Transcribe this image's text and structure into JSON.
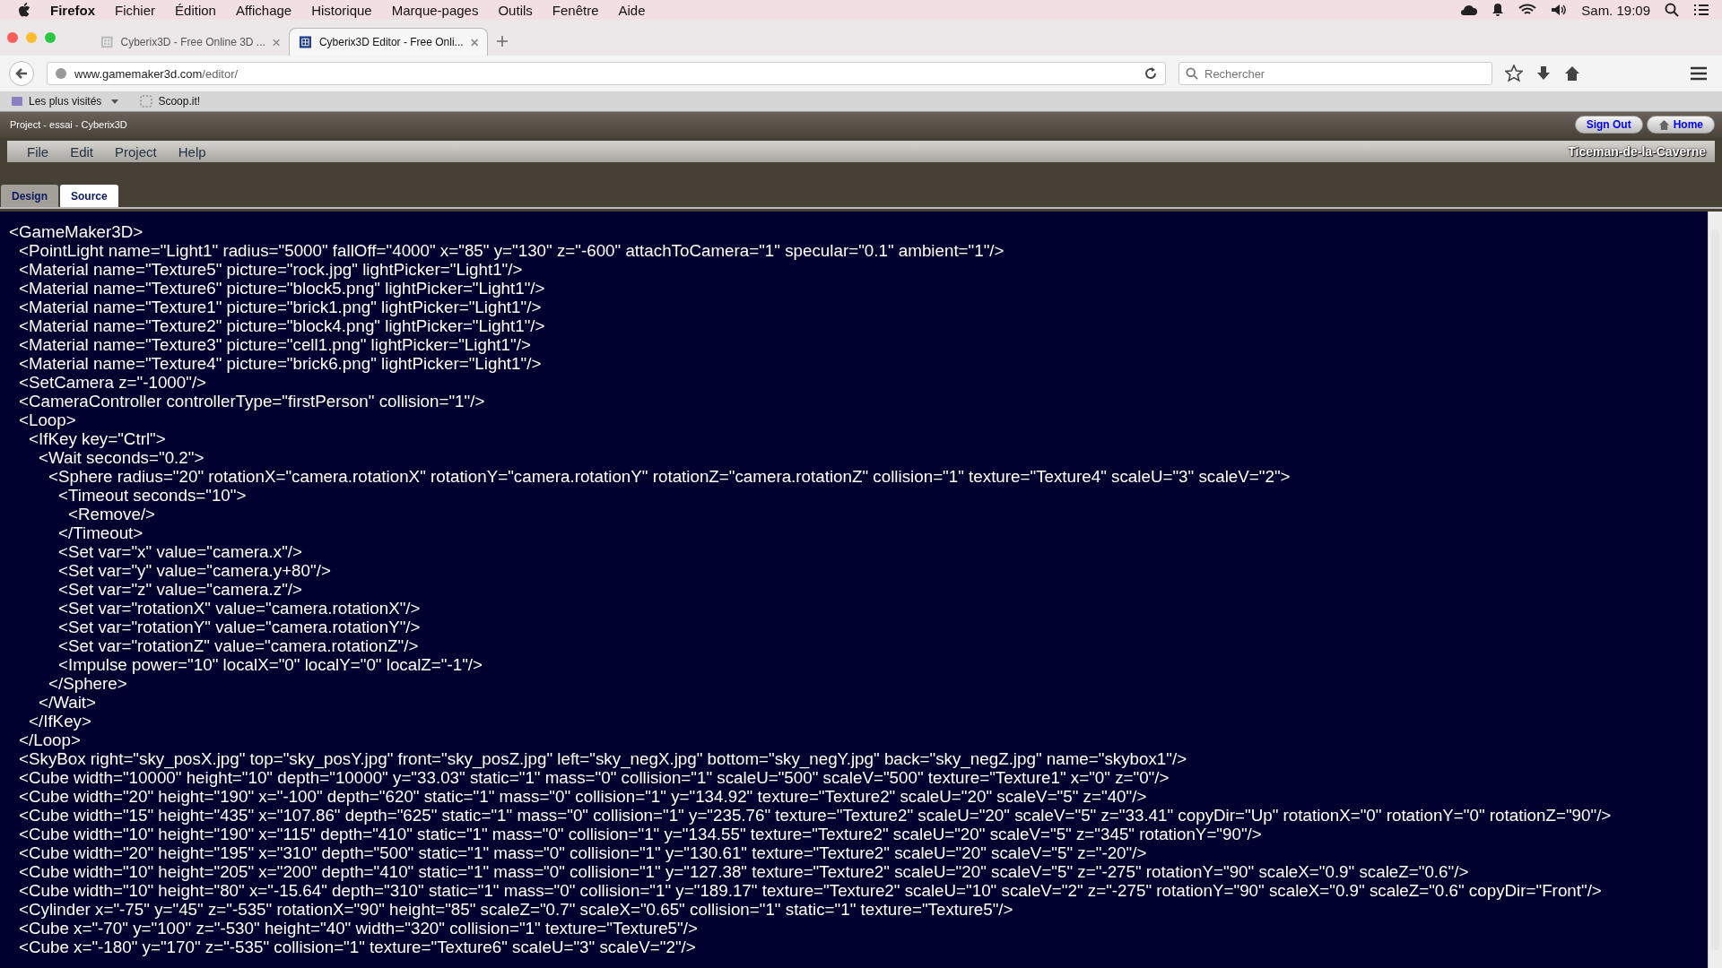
{
  "os_menu": {
    "app": "Firefox",
    "items": [
      "Fichier",
      "Édition",
      "Affichage",
      "Historique",
      "Marque-pages",
      "Outils",
      "Fenêtre",
      "Aide"
    ],
    "clock": "Sam. 19:09"
  },
  "browser_tabs": [
    {
      "title": "Cyberix3D - Free Online 3D ...",
      "selected": false
    },
    {
      "title": "Cyberix3D Editor - Free Onli...",
      "selected": true
    }
  ],
  "address_bar": {
    "domain": "www.gamemaker3d.com",
    "path": "/editor/"
  },
  "search": {
    "placeholder": "Rechercher"
  },
  "bookmarks": [
    {
      "label": "Les plus visités",
      "dropdown": true
    },
    {
      "label": "Scoop.it!",
      "dropdown": false
    }
  ],
  "app": {
    "title": "Project - essai - Cyberix3D",
    "buttons": [
      {
        "label": "Sign Out",
        "kind": "plain"
      },
      {
        "label": "Home",
        "kind": "home"
      }
    ],
    "menu": [
      "File",
      "Edit",
      "Project",
      "Help"
    ],
    "user": "Ticeman-de-la-Caverne",
    "tabs": [
      {
        "label": "Design",
        "selected": false
      },
      {
        "label": "Source",
        "selected": true
      }
    ]
  },
  "source": [
    {
      "text": "<GameMaker3D>",
      "children": [
        {
          "text": "<PointLight name=\"Light1\" radius=\"5000\" fallOff=\"4000\" x=\"85\" y=\"130\" z=\"-600\" attachToCamera=\"1\" specular=\"0.1\" ambient=\"1\"/>"
        },
        {
          "text": "<Material name=\"Texture5\" picture=\"rock.jpg\" lightPicker=\"Light1\"/>"
        },
        {
          "text": "<Material name=\"Texture6\" picture=\"block5.png\" lightPicker=\"Light1\"/>"
        },
        {
          "text": "<Material name=\"Texture1\" picture=\"brick1.png\" lightPicker=\"Light1\"/>"
        },
        {
          "text": "<Material name=\"Texture2\" picture=\"block4.png\" lightPicker=\"Light1\"/>"
        },
        {
          "text": "<Material name=\"Texture3\" picture=\"cell1.png\" lightPicker=\"Light1\"/>"
        },
        {
          "text": "<Material name=\"Texture4\" picture=\"brick6.png\" lightPicker=\"Light1\"/>"
        },
        {
          "text": "<SetCamera z=\"-1000\"/>"
        },
        {
          "text": "<CameraController controllerType=\"firstPerson\" collision=\"1\"/>"
        },
        {
          "text": "<Loop>",
          "children": [
            {
              "text": "<IfKey key=\"Ctrl\">",
              "children": [
                {
                  "text": "<Wait seconds=\"0.2\">",
                  "children": [
                    {
                      "text": "<Sphere radius=\"20\" rotationX=\"camera.rotationX\" rotationY=\"camera.rotationY\" rotationZ=\"camera.rotationZ\" collision=\"1\" texture=\"Texture4\" scaleU=\"3\" scaleV=\"2\">",
                      "children": [
                        {
                          "text": "<Timeout seconds=\"10\">",
                          "children": [
                            {
                              "text": "<Remove/>"
                            }
                          ]
                        },
                        {
                          "text": "</Timeout>"
                        },
                        {
                          "text": "<Set var=\"x\" value=\"camera.x\"/>"
                        },
                        {
                          "text": "<Set var=\"y\" value=\"camera.y+80\"/>"
                        },
                        {
                          "text": "<Set var=\"z\" value=\"camera.z\"/>"
                        },
                        {
                          "text": "<Set var=\"rotationX\" value=\"camera.rotationX\"/>"
                        },
                        {
                          "text": "<Set var=\"rotationY\" value=\"camera.rotationY\"/>"
                        },
                        {
                          "text": "<Set var=\"rotationZ\" value=\"camera.rotationZ\"/>"
                        },
                        {
                          "text": "<Impulse power=\"10\" localX=\"0\" localY=\"0\" localZ=\"-1\"/>"
                        }
                      ]
                    },
                    {
                      "text": "</Sphere>"
                    }
                  ]
                },
                {
                  "text": "</Wait>"
                }
              ]
            },
            {
              "text": "</IfKey>"
            }
          ]
        },
        {
          "text": "</Loop>"
        },
        {
          "text": "<SkyBox right=\"sky_posX.jpg\" top=\"sky_posY.jpg\" front=\"sky_posZ.jpg\" left=\"sky_negX.jpg\" bottom=\"sky_negY.jpg\" back=\"sky_negZ.jpg\" name=\"skybox1\"/>"
        },
        {
          "text": "<Cube width=\"10000\" height=\"10\" depth=\"10000\" y=\"33.03\" static=\"1\" mass=\"0\" collision=\"1\" scaleU=\"500\" scaleV=\"500\" texture=\"Texture1\" x=\"0\" z=\"0\"/>"
        },
        {
          "text": "<Cube width=\"20\" height=\"190\" x=\"-100\" depth=\"620\" static=\"1\" mass=\"0\" collision=\"1\" y=\"134.92\" texture=\"Texture2\" scaleU=\"20\" scaleV=\"5\" z=\"40\"/>"
        },
        {
          "text": "<Cube width=\"15\" height=\"435\" x=\"107.86\" depth=\"625\" static=\"1\" mass=\"0\" collision=\"1\" y=\"235.76\" texture=\"Texture2\" scaleU=\"20\" scaleV=\"5\" z=\"33.41\" copyDir=\"Up\" rotationX=\"0\" rotationY=\"0\" rotationZ=\"90\"/>"
        },
        {
          "text": "<Cube width=\"10\" height=\"190\" x=\"115\" depth=\"410\" static=\"1\" mass=\"0\" collision=\"1\" y=\"134.55\" texture=\"Texture2\" scaleU=\"20\" scaleV=\"5\" z=\"345\" rotationY=\"90\"/>"
        },
        {
          "text": "<Cube width=\"20\" height=\"195\" x=\"310\" depth=\"500\" static=\"1\" mass=\"0\" collision=\"1\" y=\"130.61\" texture=\"Texture2\" scaleU=\"20\" scaleV=\"5\" z=\"-20\"/>"
        },
        {
          "text": "<Cube width=\"10\" height=\"205\" x=\"200\" depth=\"410\" static=\"1\" mass=\"0\" collision=\"1\" y=\"127.38\" texture=\"Texture2\" scaleU=\"20\" scaleV=\"5\" z=\"-275\" rotationY=\"90\" scaleX=\"0.9\" scaleZ=\"0.6\"/>"
        },
        {
          "text": "<Cube width=\"10\" height=\"80\" x=\"-15.64\" depth=\"310\" static=\"1\" mass=\"0\" collision=\"1\" y=\"189.17\" texture=\"Texture2\" scaleU=\"10\" scaleV=\"2\" z=\"-275\" rotationY=\"90\" scaleX=\"0.9\" scaleZ=\"0.6\" copyDir=\"Front\"/>"
        },
        {
          "text": "<Cylinder x=\"-75\" y=\"45\" z=\"-535\" rotationX=\"90\" height=\"85\" scaleZ=\"0.7\" scaleX=\"0.65\" collision=\"1\" static=\"1\" texture=\"Texture5\"/>"
        },
        {
          "text": "<Cube x=\"-70\" y=\"100\" z=\"-530\" height=\"40\" width=\"320\" collision=\"1\" texture=\"Texture5\"/>"
        },
        {
          "text": "<Cube x=\"-180\" y=\"170\" z=\"-535\" collision=\"1\" texture=\"Texture6\" scaleU=\"3\" scaleV=\"2\"/>"
        }
      ]
    }
  ]
}
